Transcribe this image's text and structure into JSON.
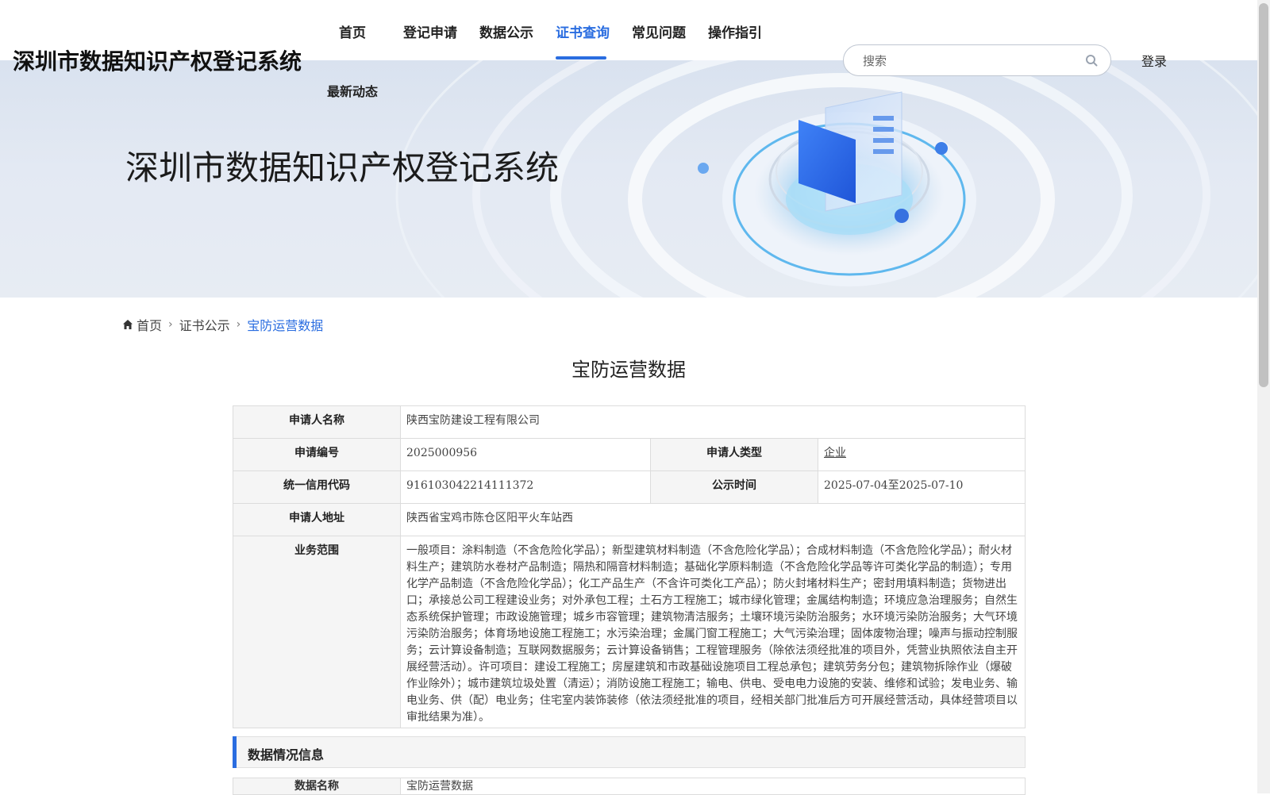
{
  "header": {
    "site_title": "深圳市数据知识产权登记系统",
    "nav": [
      "首页",
      "登记申请",
      "数据公示",
      "证书查询",
      "常见问题",
      "操作指引",
      "最新动态"
    ],
    "active_nav": "证书查询",
    "search_placeholder": "搜索",
    "login_label": "登录"
  },
  "banner": {
    "title": "深圳市数据知识产权登记系统"
  },
  "breadcrumb": {
    "home": "首页",
    "level1": "证书公示",
    "current": "宝防运营数据"
  },
  "page_title": "宝防运营数据",
  "info": {
    "applicant_name_label": "申请人名称",
    "applicant_name": "陕西宝防建设工程有限公司",
    "app_no_label": "申请编号",
    "app_no": "2025000956",
    "applicant_type_label": "申请人类型",
    "applicant_type": "企业",
    "credit_code_label": "统一信用代码",
    "credit_code": "916103042214111372",
    "publish_time_label": "公示时间",
    "publish_time": "2025-07-04至2025-07-10",
    "address_label": "申请人地址",
    "address": "陕西省宝鸡市陈仓区阳平火车站西",
    "scope_label": "业务范围",
    "scope": "一般项目：涂料制造（不含危险化学品）；新型建筑材料制造（不含危险化学品）；合成材料制造（不含危险化学品）；耐火材料生产；建筑防水卷材产品制造；隔热和隔音材料制造；基础化学原料制造（不含危险化学品等许可类化学品的制造）；专用化学产品制造（不含危险化学品）；化工产品生产（不含许可类化工产品）；防火封堵材料生产；密封用填料制造；货物进出口；承接总公司工程建设业务；对外承包工程；土石方工程施工；城市绿化管理；金属结构制造；环境应急治理服务；自然生态系统保护管理；市政设施管理；城乡市容管理；建筑物清洁服务；土壤环境污染防治服务；水环境污染防治服务；大气环境污染防治服务；体育场地设施工程施工；水污染治理；金属门窗工程施工；大气污染治理；固体废物治理；噪声与振动控制服务；云计算设备制造；互联网数据服务；云计算设备销售；工程管理服务（除依法须经批准的项目外，凭营业执照依法自主开展经营活动）。许可项目：建设工程施工；房屋建筑和市政基础设施项目工程总承包；建筑劳务分包；建筑物拆除作业（爆破作业除外）；城市建筑垃圾处置（清运）；消防设施工程施工；输电、供电、受电电力设施的安装、维修和试验；发电业务、输电业务、供（配）电业务；住宅室内装饰装修（依法须经批准的项目，经相关部门批准后方可开展经营活动，具体经营项目以审批结果为准）。"
  },
  "data_section": {
    "title": "数据情况信息",
    "name_label": "数据名称",
    "name": "宝防运营数据"
  },
  "colors": {
    "accent": "#2a6de0",
    "label_bg": "#f5f5f5",
    "border": "#dcdcdc"
  }
}
